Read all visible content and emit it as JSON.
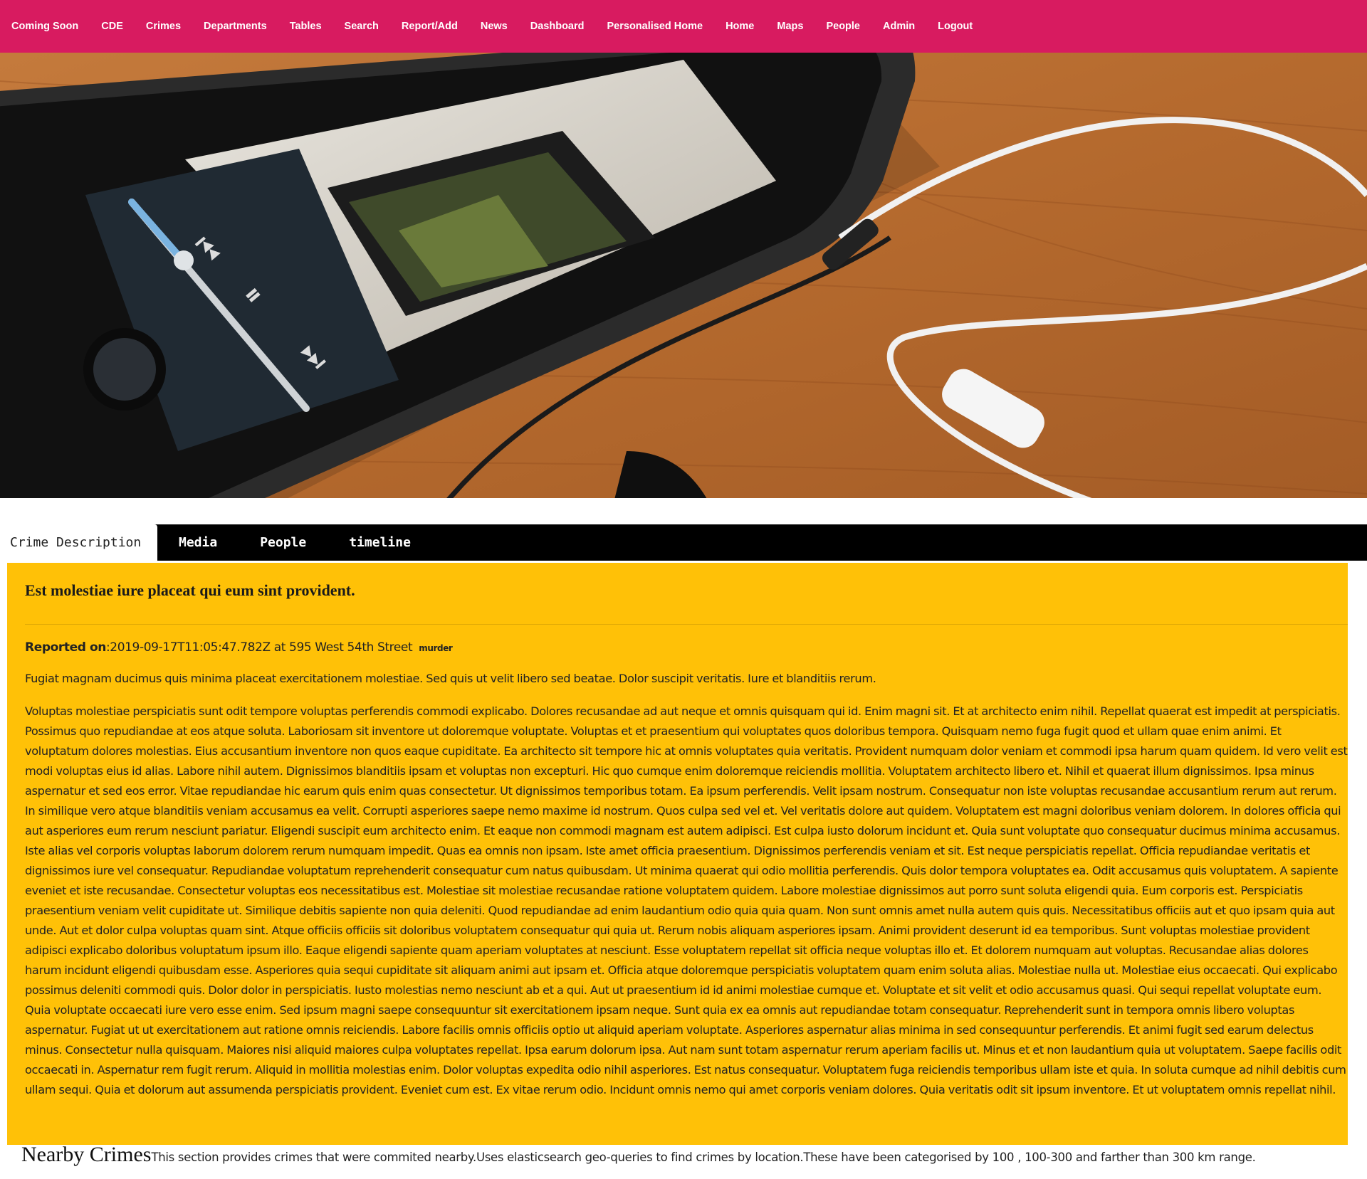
{
  "nav": {
    "items": [
      "Coming Soon",
      "CDE",
      "Crimes",
      "Departments",
      "Tables",
      "Search",
      "Report/Add",
      "News",
      "Dashboard",
      "Personalised Home",
      "Home",
      "Maps",
      "People",
      "Admin",
      "Logout"
    ]
  },
  "tabs": {
    "items": [
      "Crime Description",
      "Media",
      "People",
      "timeline"
    ],
    "active": "Crime Description"
  },
  "crime": {
    "title": "Est molestiae iure placeat qui eum sint provident.",
    "reported_label": "Reported on",
    "reported_value": ":2019-09-17T11:05:47.782Z at 595 West 54th Street",
    "category": "murder",
    "summary": "Fugiat magnam ducimus quis minima placeat exercitationem molestiae. Sed quis ut velit libero sed beatae. Dolor suscipit veritatis. Iure et blanditiis rerum.",
    "description": "Voluptas molestiae perspiciatis sunt odit tempore voluptas perferendis commodi explicabo. Dolores recusandae ad aut neque et omnis quisquam qui id. Enim magni sit. Et at architecto enim nihil. Repellat quaerat est impedit at perspiciatis. Possimus quo repudiandae at eos atque soluta. Laboriosam sit inventore ut doloremque voluptate. Voluptas et et praesentium qui voluptates quos doloribus tempora. Quisquam nemo fuga fugit quod et ullam quae enim animi. Et voluptatum dolores molestias. Eius accusantium inventore non quos eaque cupiditate. Ea architecto sit tempore hic at omnis voluptates quia veritatis. Provident numquam dolor veniam et commodi ipsa harum quam quidem. Id vero velit est modi voluptas eius id alias. Labore nihil autem. Dignissimos blanditiis ipsam et voluptas non excepturi. Hic quo cumque enim doloremque reiciendis mollitia. Voluptatem architecto libero et. Nihil et quaerat illum dignissimos. Ipsa minus aspernatur et sed eos error. Vitae repudiandae hic earum quis enim quas consectetur. Ut dignissimos temporibus totam. Ea ipsum perferendis. Velit ipsam nostrum. Consequatur non iste voluptas recusandae accusantium rerum aut rerum. In similique vero atque blanditiis veniam accusamus ea velit. Corrupti asperiores saepe nemo maxime id nostrum. Quos culpa sed vel et. Vel veritatis dolore aut quidem. Voluptatem est magni doloribus veniam dolorem. In dolores officia qui aut asperiores eum rerum nesciunt pariatur. Eligendi suscipit eum architecto enim. Et eaque non commodi magnam est autem adipisci. Est culpa iusto dolorum incidunt et. Quia sunt voluptate quo consequatur ducimus minima accusamus. Iste alias vel corporis voluptas laborum dolorem rerum numquam impedit. Quas ea omnis non ipsam. Iste amet officia praesentium. Dignissimos perferendis veniam et sit. Est neque perspiciatis repellat. Officia repudiandae veritatis et dignissimos iure vel consequatur. Repudiandae voluptatum reprehenderit consequatur cum natus quibusdam. Ut minima quaerat qui odio mollitia perferendis. Quis dolor tempora voluptates ea. Odit accusamus quis voluptatem. A sapiente eveniet et iste recusandae. Consectetur voluptas eos necessitatibus est. Molestiae sit molestiae recusandae ratione voluptatem quidem. Labore molestiae dignissimos aut porro sunt soluta eligendi quia. Eum corporis est. Perspiciatis praesentium veniam velit cupiditate ut. Similique debitis sapiente non quia deleniti. Quod repudiandae ad enim laudantium odio quia quia quam. Non sunt omnis amet nulla autem quis quis. Necessitatibus officiis aut et quo ipsam quia aut unde. Aut et dolor culpa voluptas quam sint. Atque officiis officiis sit doloribus voluptatem consequatur qui quia ut. Rerum nobis aliquam asperiores ipsam. Animi provident deserunt id ea temporibus. Sunt voluptas molestiae provident adipisci explicabo doloribus voluptatum ipsum illo. Eaque eligendi sapiente quam aperiam voluptates at nesciunt. Esse voluptatem repellat sit officia neque voluptas illo et. Et dolorem numquam aut voluptas. Recusandae alias dolores harum incidunt eligendi quibusdam esse. Asperiores quia sequi cupiditate sit aliquam animi aut ipsam et. Officia atque doloremque perspiciatis voluptatem quam enim soluta alias. Molestiae nulla ut. Molestiae eius occaecati. Qui explicabo possimus deleniti commodi quis. Dolor dolor in perspiciatis. Iusto molestias nemo nesciunt ab et a qui. Aut ut praesentium id id animi molestiae cumque et. Voluptate et sit velit et odio accusamus quasi. Qui sequi repellat voluptate eum. Quia voluptate occaecati iure vero esse enim. Sed ipsum magni saepe consequuntur sit exercitationem ipsam neque. Sunt quia ex ea omnis aut repudiandae totam consequatur. Reprehenderit sunt in tempora omnis libero voluptas aspernatur. Fugiat ut ut exercitationem aut ratione omnis reiciendis. Labore facilis omnis officiis optio ut aliquid aperiam voluptate. Asperiores aspernatur alias minima in sed consequuntur perferendis. Et animi fugit sed earum delectus minus. Consectetur nulla quisquam. Maiores nisi aliquid maiores culpa voluptates repellat. Ipsa earum dolorum ipsa. Aut nam sunt totam aspernatur rerum aperiam facilis ut. Minus et et non laudantium quia ut voluptatem. Saepe facilis odit occaecati in. Aspernatur rem fugit rerum. Aliquid in mollitia molestias enim. Dolor voluptas expedita odio nihil asperiores. Est natus consequatur. Voluptatem fuga reiciendis temporibus ullam iste et quia. In soluta cumque ad nihil debitis cum ullam sequi. Quia et dolorum aut assumenda perspiciatis provident. Eveniet cum est. Ex vitae rerum odio. Incidunt omnis nemo qui amet corporis veniam dolores. Quia veritatis odit sit ipsum inventore. Et ut voluptatem omnis repellat nihil."
  },
  "nearby": {
    "title": "Nearby Crimes",
    "description": "This section provides crimes that were commited nearby.Uses elasticsearch geo-queries to find crimes by location.These have been categorised by 100 , 100-300 and farther than 300 km range."
  },
  "colors": {
    "nav_bg": "#d81b60",
    "panel_bg": "#ffc107",
    "tabbar_bg": "#000000"
  }
}
